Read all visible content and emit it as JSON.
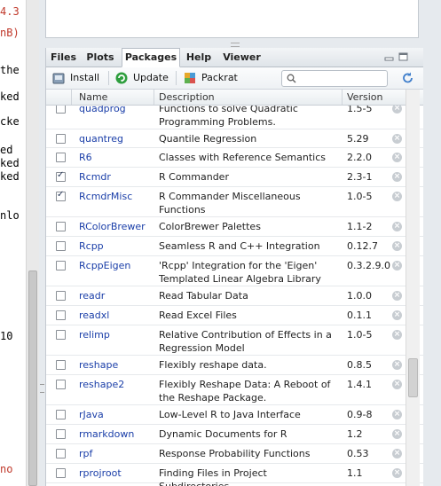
{
  "console": {
    "lines": [
      {
        "text": "4.3",
        "color": "#c0392b"
      },
      {
        "text": "nB)",
        "color": "#c0392b"
      },
      {
        "text": "the",
        "color": "#000000"
      },
      {
        "text": "ked",
        "color": "#000000"
      },
      {
        "text": "cke",
        "color": "#000000"
      },
      {
        "text": "ed",
        "color": "#000000"
      },
      {
        "text": "ked",
        "color": "#000000"
      },
      {
        "text": "ked",
        "color": "#000000"
      },
      {
        "text": "nlo",
        "color": "#000000"
      },
      {
        "text": "10",
        "color": "#000000"
      },
      {
        "text": "no",
        "color": "#c0392b"
      }
    ]
  },
  "tabs": [
    {
      "label": "Files",
      "selected": false
    },
    {
      "label": "Plots",
      "selected": false
    },
    {
      "label": "Packages",
      "selected": true
    },
    {
      "label": "Help",
      "selected": false
    },
    {
      "label": "Viewer",
      "selected": false
    }
  ],
  "toolbar": {
    "install_label": "Install",
    "update_label": "Update",
    "packrat_label": "Packrat",
    "search_placeholder": ""
  },
  "table": {
    "headers": {
      "name": "Name",
      "description": "Description",
      "version": "Version"
    },
    "rows": [
      {
        "name": "quadprog",
        "description": "Functions to solve Quadratic Programming Problems.",
        "version": "1.5-5",
        "checked": false
      },
      {
        "name": "quantreg",
        "description": "Quantile Regression",
        "version": "5.29",
        "checked": false
      },
      {
        "name": "R6",
        "description": "Classes with Reference Semantics",
        "version": "2.2.0",
        "checked": false
      },
      {
        "name": "Rcmdr",
        "description": "R Commander",
        "version": "2.3-1",
        "checked": true
      },
      {
        "name": "RcmdrMisc",
        "description": "R Commander Miscellaneous Functions",
        "version": "1.0-5",
        "checked": true
      },
      {
        "name": "RColorBrewer",
        "description": "ColorBrewer Palettes",
        "version": "1.1-2",
        "checked": false
      },
      {
        "name": "Rcpp",
        "description": "Seamless R and C++ Integration",
        "version": "0.12.7",
        "checked": false
      },
      {
        "name": "RcppEigen",
        "description": "'Rcpp' Integration for the 'Eigen' Templated Linear Algebra Library",
        "version": "0.3.2.9.0",
        "checked": false
      },
      {
        "name": "readr",
        "description": "Read Tabular Data",
        "version": "1.0.0",
        "checked": false
      },
      {
        "name": "readxl",
        "description": "Read Excel Files",
        "version": "0.1.1",
        "checked": false
      },
      {
        "name": "relimp",
        "description": "Relative Contribution of Effects in a Regression Model",
        "version": "1.0-5",
        "checked": false
      },
      {
        "name": "reshape",
        "description": "Flexibly reshape data.",
        "version": "0.8.5",
        "checked": false
      },
      {
        "name": "reshape2",
        "description": "Flexibly Reshape Data: A Reboot of the Reshape Package.",
        "version": "1.4.1",
        "checked": false
      },
      {
        "name": "rJava",
        "description": "Low-Level R to Java Interface",
        "version": "0.9-8",
        "checked": false
      },
      {
        "name": "rmarkdown",
        "description": "Dynamic Documents for R",
        "version": "1.2",
        "checked": false
      },
      {
        "name": "rpf",
        "description": "Response Probability Functions",
        "version": "0.53",
        "checked": false
      },
      {
        "name": "rprojroot",
        "description": "Finding Files in Project Subdirectories",
        "version": "1.1",
        "checked": false
      }
    ]
  },
  "colors": {
    "link": "#1a3ea8",
    "accent_update": "#2e9e3e",
    "console_error": "#c0392b"
  }
}
